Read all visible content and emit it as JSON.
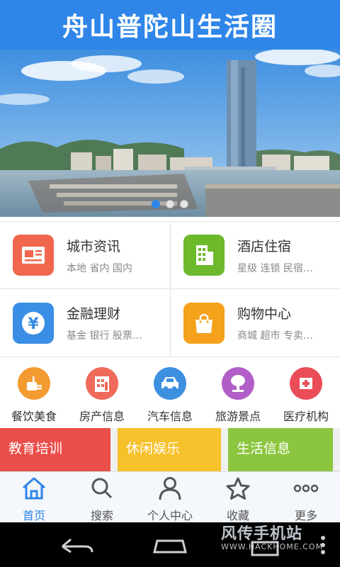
{
  "header": {
    "title": "舟山普陀山生活圈"
  },
  "banner": {
    "dots_total": 3,
    "active_index": 0
  },
  "main_services": [
    {
      "title": "城市资讯",
      "subtitle": "本地 省内 国内",
      "icon": "newspaper-icon",
      "color": "#f0674e"
    },
    {
      "title": "酒店住宿",
      "subtitle": "星级 连锁 民宿…",
      "icon": "building-icon",
      "color": "#6cb92c"
    },
    {
      "title": "金融理财",
      "subtitle": "基金 银行 股票…",
      "icon": "yen-icon",
      "color": "#3a8ee6"
    },
    {
      "title": "购物中心",
      "subtitle": "商城 超市 专卖…",
      "icon": "shopping-bag-icon",
      "color": "#f5a11c"
    }
  ],
  "categories": [
    {
      "label": "餐饮美食",
      "icon": "food-icon",
      "color": "#f39a30"
    },
    {
      "label": "房产信息",
      "icon": "house-icon",
      "color": "#ef6a5a"
    },
    {
      "label": "汽车信息",
      "icon": "car-icon",
      "color": "#3d8fe0"
    },
    {
      "label": "旅游景点",
      "icon": "tree-icon",
      "color": "#b25ec8"
    },
    {
      "label": "医疗机构",
      "icon": "hospital-icon",
      "color": "#ea4d57"
    }
  ],
  "feature_cards": [
    {
      "label": "教育培训",
      "color": "#ea4e4a"
    },
    {
      "label": "休闲娱乐",
      "color": "#f6c12a"
    },
    {
      "label": "生活信息",
      "color": "#8cc63f"
    }
  ],
  "tabs": [
    {
      "label": "首页",
      "icon": "home-icon",
      "active": true
    },
    {
      "label": "搜索",
      "icon": "search-icon",
      "active": false
    },
    {
      "label": "个人中心",
      "icon": "user-icon",
      "active": false
    },
    {
      "label": "收藏",
      "icon": "star-icon",
      "active": false
    },
    {
      "label": "更多",
      "icon": "more-icon",
      "active": false
    }
  ],
  "watermark": {
    "line1": "风传手机站",
    "line2": "WWW.HACKHOME.COM"
  },
  "colors": {
    "accent": "#2f86e8"
  }
}
